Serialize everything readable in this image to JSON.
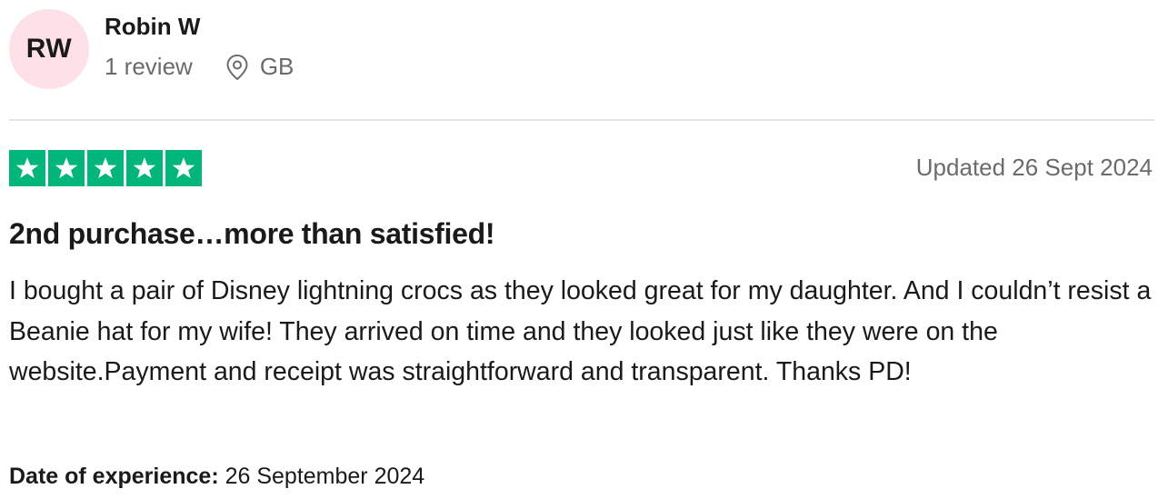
{
  "reviewer": {
    "initials": "RW",
    "name": "Robin W",
    "review_count": "1 review",
    "country": "GB",
    "location_icon": "map-pin-icon"
  },
  "rating": {
    "stars": 5,
    "max_stars": 5,
    "star_color": "#00b67a"
  },
  "review": {
    "updated": "Updated 26 Sept 2024",
    "title": "2nd purchase…more than satisfied!",
    "body": "I bought a pair of Disney lightning crocs as they looked great for my daughter. And I couldn’t resist a Beanie hat for my wife! They arrived on time and they looked just like they were on the website.Payment and receipt was straightforward and transparent. Thanks PD!",
    "experience_label": "Date of experience:",
    "experience_date": "26 September 2024"
  },
  "colors": {
    "avatar_bg": "#fde1e6",
    "muted_text": "#6b6b6b",
    "divider": "#e5e5e5"
  }
}
